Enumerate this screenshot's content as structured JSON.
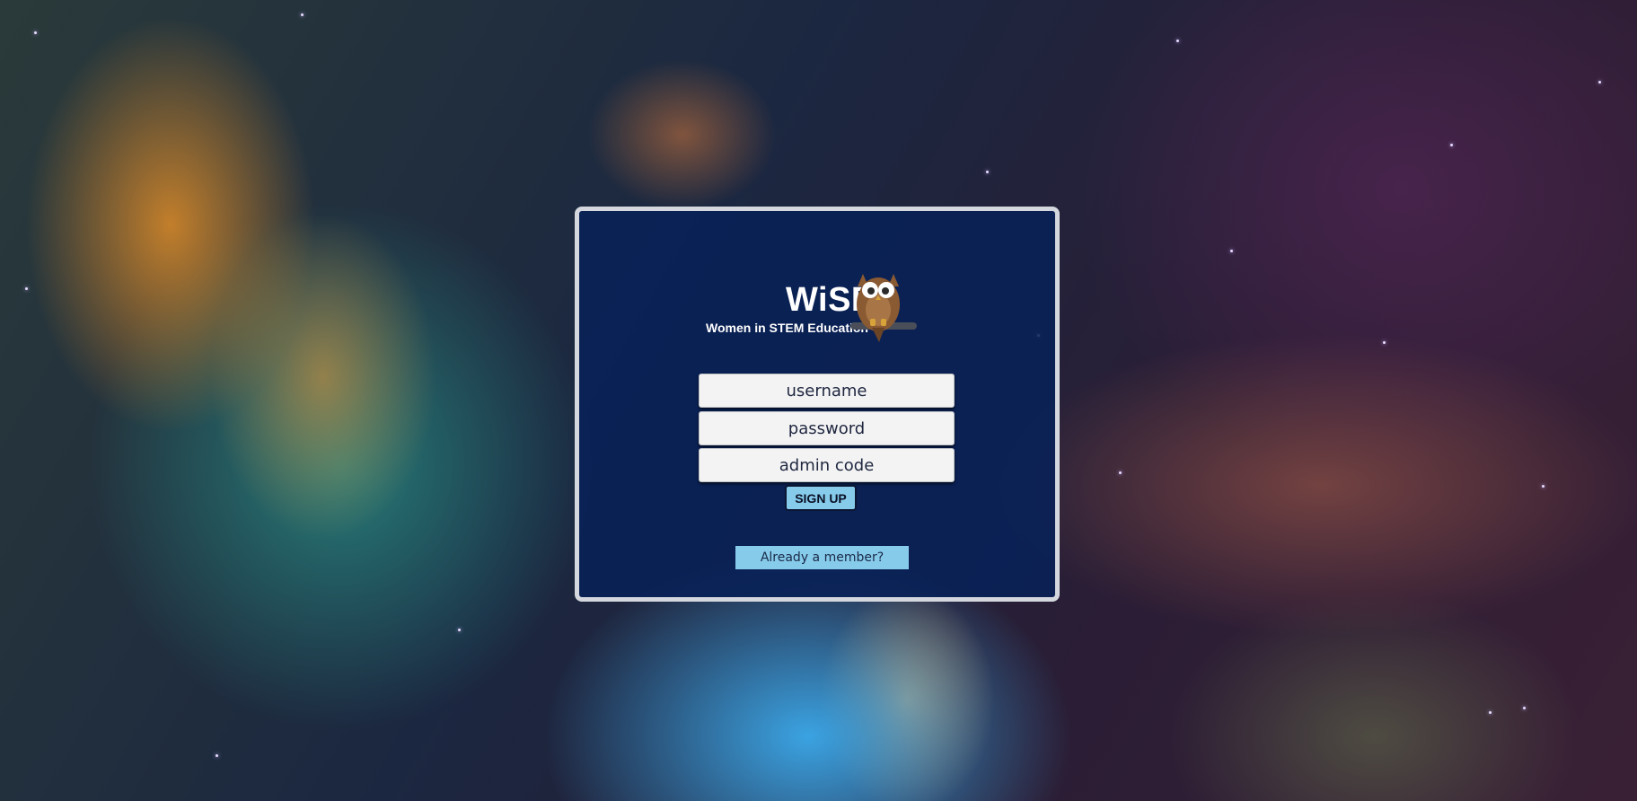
{
  "brand": {
    "title": "WiSE",
    "subtitle": "Women in STEM Education",
    "logo_icon": "owl-icon"
  },
  "form": {
    "username_placeholder": "username",
    "password_placeholder": "password",
    "admin_code_placeholder": "admin code",
    "signup_label": "SIGN UP",
    "member_link_label": "Already a member?"
  },
  "colors": {
    "panel_background": "#082158",
    "panel_border": "#d4d8de",
    "button_accent": "#87cbeb",
    "input_background": "#f3f3f3"
  }
}
